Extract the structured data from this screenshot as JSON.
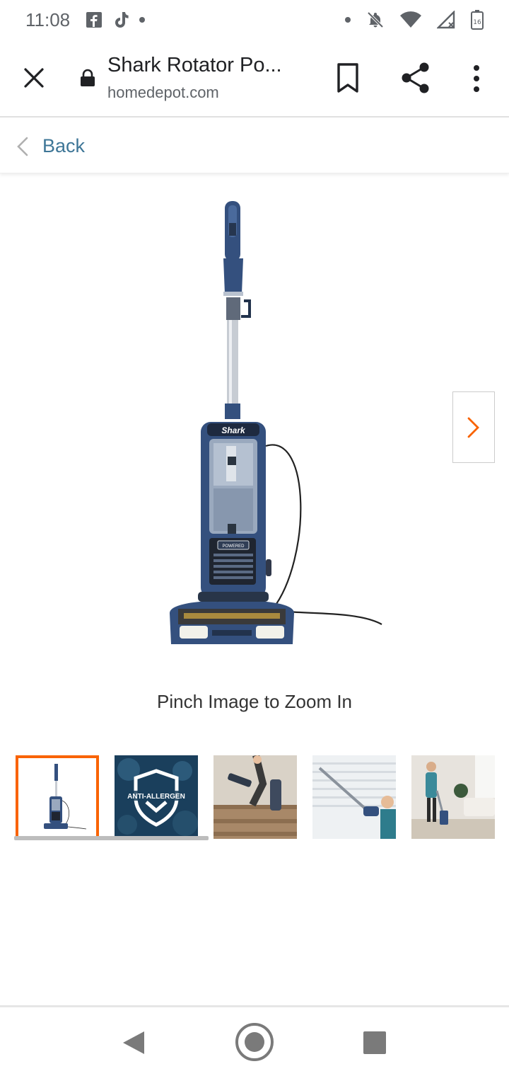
{
  "status_bar": {
    "time": "11:08",
    "battery_level": "16",
    "icons": [
      "facebook-icon",
      "tiktok-icon",
      "notification-dot",
      "mute-icon",
      "wifi-icon",
      "signal-icon",
      "battery-icon"
    ]
  },
  "toolbar": {
    "title": "Shark Rotator Po...",
    "domain": "homedepot.com",
    "icons": [
      "close-icon",
      "lock-icon",
      "bookmark-icon",
      "share-icon",
      "more-vert-icon"
    ]
  },
  "back_bar": {
    "label": "Back"
  },
  "gallery": {
    "zoom_hint": "Pinch Image to Zoom In",
    "main_image_brand": "Shark",
    "main_image_badge": "POWERED",
    "selected_index": 0,
    "thumbnails": [
      {
        "name": "thumb-vacuum-full",
        "label": ""
      },
      {
        "name": "thumb-anti-allergen",
        "label": "ANTI-ALLERGEN"
      },
      {
        "name": "thumb-stairs-cleaning",
        "label": ""
      },
      {
        "name": "thumb-wand-reach",
        "label": ""
      },
      {
        "name": "thumb-living-room",
        "label": ""
      }
    ]
  },
  "colors": {
    "accent": "#f96302",
    "link": "#3e7697",
    "vacuum_blue": "#34507e"
  }
}
